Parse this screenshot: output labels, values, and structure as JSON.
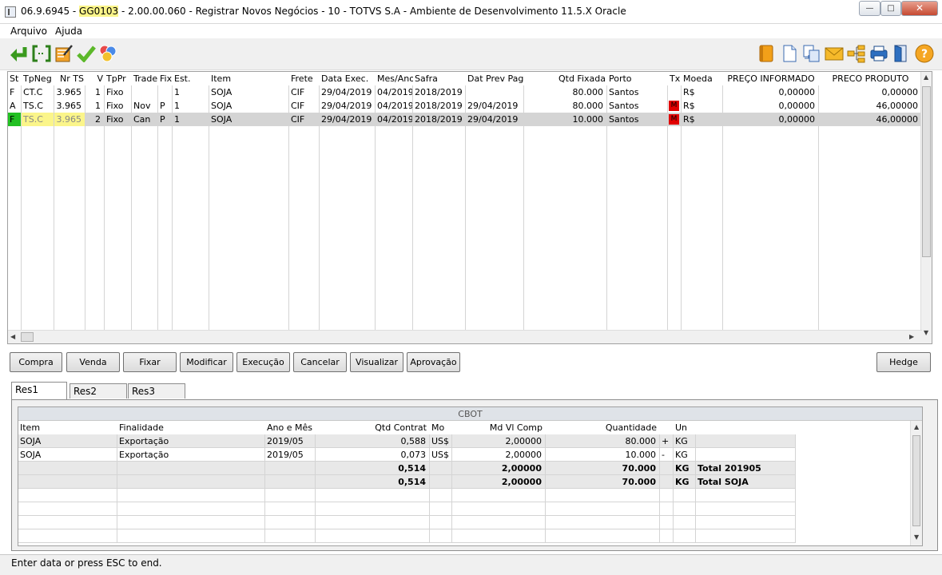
{
  "window": {
    "title_prefix": "06.9.6945 - ",
    "title_code": "GG0103",
    "title_suffix": " - 2.00.00.060 - Registrar Novos Negócios - 10 - TOTVS S.A - Ambiente de Desenvolvimento 11.5.X Oracle",
    "minimize": "—",
    "maximize": "□",
    "close": "✕"
  },
  "menu": [
    "Arquivo",
    "Ajuda"
  ],
  "toolbar_icons": [
    "return-icon",
    "bracket-icon",
    "edit-icon",
    "check-icon",
    "circles-icon",
    "book-icon",
    "new-document-icon",
    "copy-icon",
    "mail-icon",
    "tree-icon",
    "print-icon",
    "exit-icon",
    "help-icon"
  ],
  "grid": {
    "columns": [
      "St",
      "TpNeg",
      "Nr TS",
      "V",
      "TpPr",
      "Trade",
      "Fix",
      "Est.",
      "Item",
      "Frete",
      "Data Exec.",
      "Mes/Ano",
      "Safra",
      "Dat Prev Pag",
      "Qtd Fixada",
      "Porto",
      "Tx",
      "Moeda",
      "PREÇO INFORMADO",
      "PRECO PRODUTO"
    ],
    "rows": [
      [
        "F",
        "CT.C",
        "3.965",
        "1",
        "Fixo",
        "",
        "",
        "1",
        "SOJA",
        "CIF",
        "29/04/2019",
        "04/2019",
        "2018/2019",
        "",
        "80.000",
        "Santos",
        "",
        "R$",
        "0,00000",
        "0,00000"
      ],
      [
        "A",
        "TS.C",
        "3.965",
        "1",
        "Fixo",
        "Nov",
        "P",
        "1",
        "SOJA",
        "CIF",
        "29/04/2019",
        "04/2019",
        "2018/2019",
        "29/04/2019",
        "80.000",
        "Santos",
        "M",
        "R$",
        "0,00000",
        "46,00000"
      ],
      [
        "F",
        "TS.C",
        "3.965",
        "2",
        "Fixo",
        "Can",
        "P",
        "1",
        "SOJA",
        "CIF",
        "29/04/2019",
        "04/2019",
        "2018/2019",
        "29/04/2019",
        "10.000",
        "Santos",
        "M",
        "R$",
        "0,00000",
        "46,00000"
      ]
    ]
  },
  "buttons": [
    "Compra",
    "Venda",
    "Fixar",
    "Modificar",
    "Execução",
    "Cancelar",
    "Visualizar",
    "Aprovação",
    "Hedge"
  ],
  "tabs": [
    "Res1",
    "Res2",
    "Res3"
  ],
  "result": {
    "group_header": "CBOT",
    "columns": [
      "Item",
      "Finalidade",
      "Ano e Mês",
      "Qtd Contrat",
      "Mo",
      "Md Vl Comp",
      "Quantidade",
      "",
      "Un",
      ""
    ],
    "rows": [
      [
        "SOJA",
        "Exportação",
        "2019/05",
        "0,588",
        "US$",
        "2,00000",
        "80.000",
        "+",
        "KG",
        ""
      ],
      [
        "SOJA",
        "Exportação",
        "2019/05",
        "0,073",
        "US$",
        "2,00000",
        "10.000",
        "-",
        "KG",
        ""
      ],
      [
        "",
        "",
        "",
        "0,514",
        "",
        "2,00000",
        "70.000",
        "",
        "KG",
        "Total 201905"
      ],
      [
        "",
        "",
        "",
        "0,514",
        "",
        "2,00000",
        "70.000",
        "",
        "KG",
        "Total SOJA"
      ]
    ]
  },
  "status": "Enter data or press ESC to end.",
  "colors": {
    "highlight": "#fbf58a",
    "selected_row": "#d4d4d4",
    "status_green": "#22c022",
    "tax_red": "#e00000"
  }
}
